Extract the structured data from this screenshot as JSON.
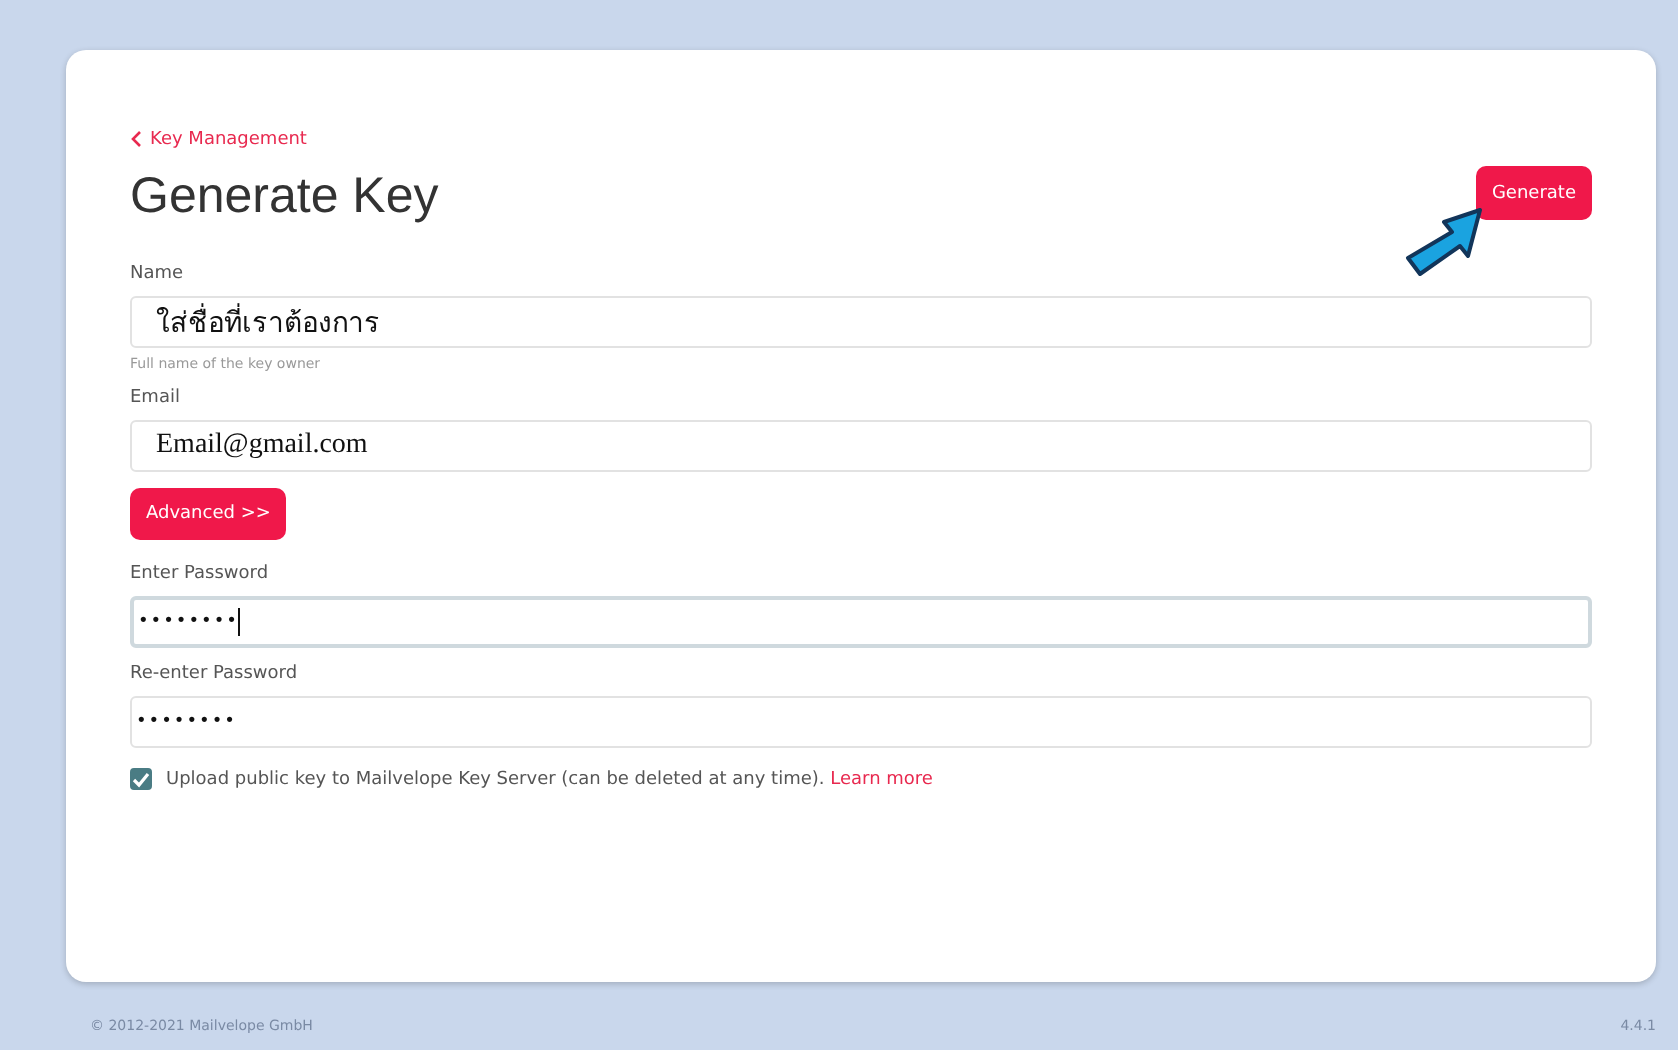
{
  "back_link": {
    "label": "Key Management"
  },
  "title": "Generate Key",
  "generate_button": {
    "label": "Generate"
  },
  "fields": [
    {
      "kind": "text",
      "label": "Name",
      "value": "ใส่ชื่อที่เราต้องการ",
      "hint": "Full name of the key owner",
      "focused": false
    },
    {
      "kind": "text",
      "label": "Email",
      "value": "Email@gmail.com",
      "focused": false
    },
    {
      "kind": "button",
      "label": "Advanced >>"
    },
    {
      "kind": "password",
      "label": "Enter Password",
      "value": "••••••••",
      "focused": true
    },
    {
      "kind": "password",
      "label": "Re-enter Password",
      "value": "••••••••",
      "focused": false
    }
  ],
  "upload": {
    "checked": true,
    "label": "Upload public key to Mailvelope Key Server (can be deleted at any time).",
    "link": "Learn more"
  },
  "footer": {
    "copyright": "© 2012-2021  Mailvelope GmbH",
    "version": "4.4.1"
  }
}
